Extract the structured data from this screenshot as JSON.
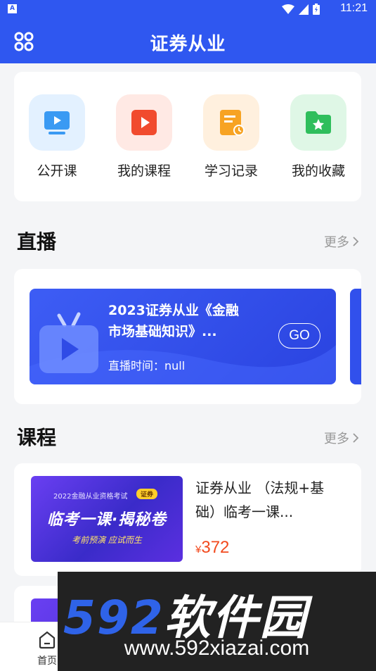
{
  "status_bar": {
    "badge": "A",
    "time": "11:21"
  },
  "app_bar": {
    "title": "证券从业"
  },
  "quick_links": [
    {
      "label": "公开课",
      "icon": "video-screen-icon"
    },
    {
      "label": "我的课程",
      "icon": "play-icon"
    },
    {
      "label": "学习记录",
      "icon": "record-clock-icon"
    },
    {
      "label": "我的收藏",
      "icon": "folder-star-icon"
    }
  ],
  "live_section": {
    "title": "直播",
    "more": "更多",
    "items": [
      {
        "title": "2023证券从业《金融市场基础知识》...",
        "time_label": "直播时间：",
        "time_value": "null",
        "button": "GO"
      }
    ]
  },
  "course_section": {
    "title": "课程",
    "more": "更多",
    "items": [
      {
        "thumb_top": "2022金融从业资格考试",
        "thumb_tag": "证券",
        "thumb_main": "临考一课·揭秘卷",
        "thumb_sub": "考前预演  应试而生",
        "title": "证券从业 （法规+基础）临考一课...",
        "currency": "¥",
        "price": "372"
      }
    ]
  },
  "tab_bar": {
    "home_label": "首页"
  },
  "watermark": {
    "number": "592",
    "brand": "软件园",
    "url": "www.592xiazai.com"
  },
  "colors": {
    "primary": "#2f57f0",
    "price": "#f24a1e"
  }
}
